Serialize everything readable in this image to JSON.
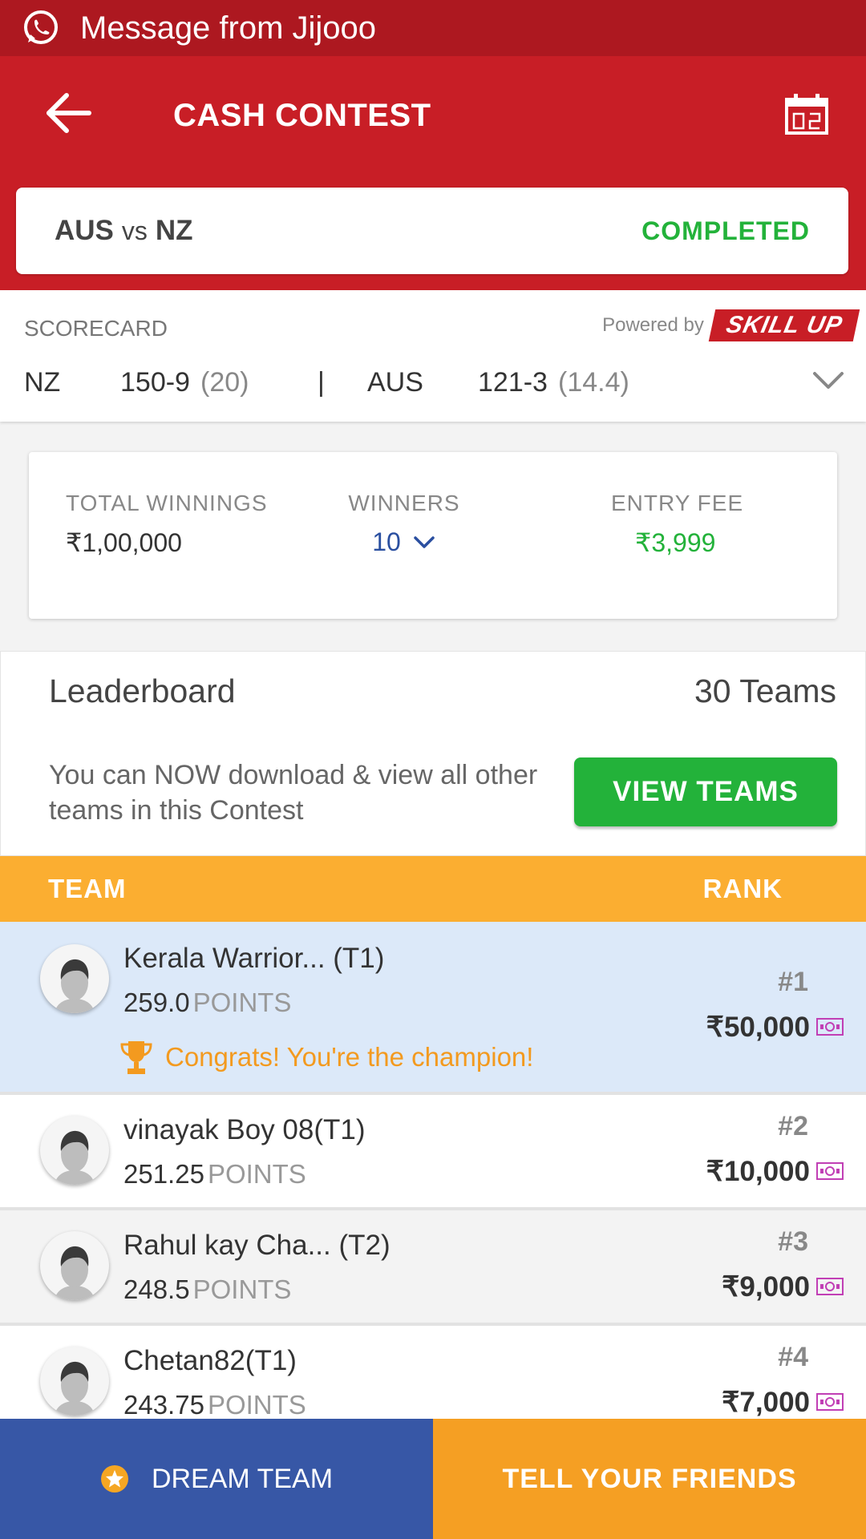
{
  "notification": {
    "text": "Message from Jijooo"
  },
  "header": {
    "title": "CASH CONTEST"
  },
  "match": {
    "team1": "AUS",
    "vs": "vs",
    "team2": "NZ",
    "status": "COMPLETED"
  },
  "scorecard": {
    "label": "SCORECARD",
    "powered_by": "Powered by",
    "brand": "SKILL UP",
    "team1": "NZ",
    "team1_score": "150-9",
    "team1_overs": "(20)",
    "separator": "|",
    "team2": "AUS",
    "team2_score": "121-3",
    "team2_overs": "(14.4)"
  },
  "contest": {
    "total_winnings_label": "TOTAL WINNINGS",
    "total_winnings": "₹1,00,000",
    "winners_label": "WINNERS",
    "winners": "10",
    "entry_fee_label": "ENTRY FEE",
    "entry_fee": "₹3,999"
  },
  "leaderboard": {
    "title": "Leaderboard",
    "teams_count": "30 Teams",
    "description": "You can NOW download & view all other teams in this Contest",
    "view_teams_button": "VIEW TEAMS"
  },
  "table": {
    "col_team": "TEAM",
    "col_rank": "RANK",
    "points_label": "POINTS",
    "rows": [
      {
        "name": "Kerala Warrior...",
        "tag": " (T1)",
        "points": "259.0",
        "rank": "#1",
        "prize": "₹50,000",
        "congrats": "Congrats! You're the champion!"
      },
      {
        "name": "vinayak Boy 08",
        "tag": "(T1)",
        "points": "251.25",
        "rank": "#2",
        "prize": "₹10,000"
      },
      {
        "name": "Rahul kay Cha...",
        "tag": " (T2)",
        "points": "248.5",
        "rank": "#3",
        "prize": "₹9,000"
      },
      {
        "name": "Chetan82",
        "tag": "(T1)",
        "points": "243.75",
        "rank": "#4",
        "prize": "₹7,000"
      }
    ]
  },
  "bottom": {
    "dream_team": "DREAM TEAM",
    "tell_friends": "TELL YOUR FRIENDS"
  },
  "colors": {
    "primary_red": "#c81e26",
    "green": "#23b23a",
    "orange": "#fbae31",
    "blue": "#3757a6",
    "highlight_row": "#dce9f9"
  }
}
